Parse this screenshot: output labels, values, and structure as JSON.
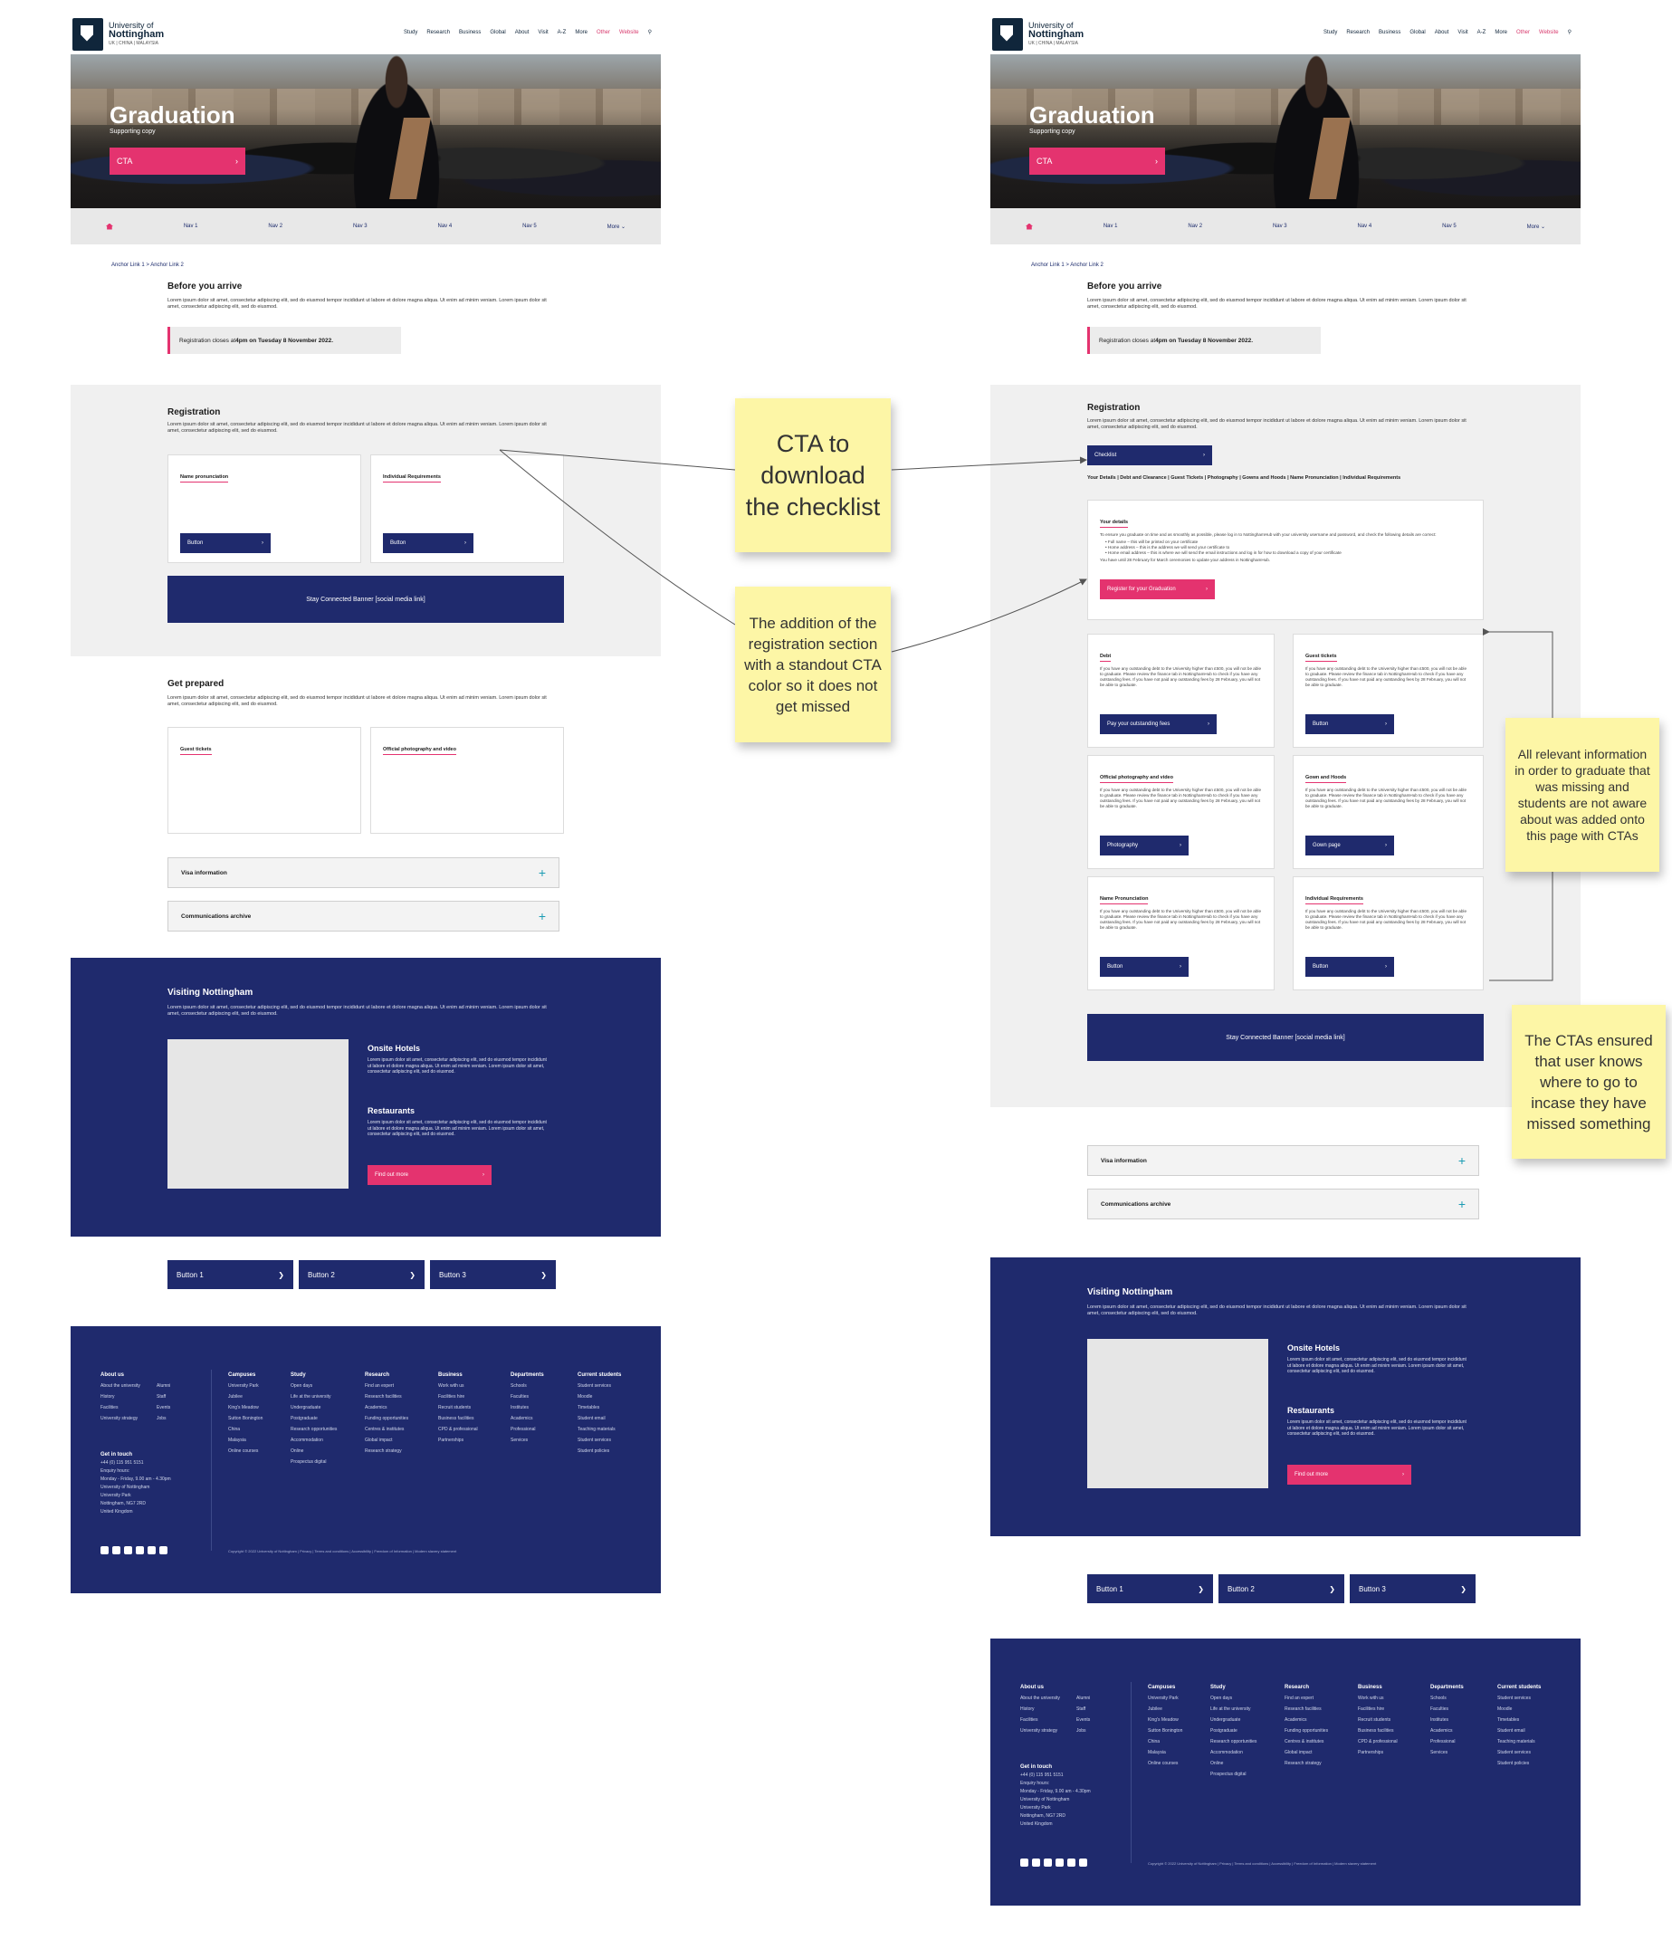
{
  "header": {
    "logo_line1": "University of",
    "logo_line2": "Nottingham",
    "logo_line3": "UK | CHINA | MALAYSIA",
    "nav": [
      "Study",
      "Research",
      "Business",
      "Global",
      "About",
      "Visit",
      "A-Z",
      "More"
    ],
    "lang": "Other",
    "website": "Website"
  },
  "hero": {
    "title": "Graduation",
    "supporting": "Supporting copy",
    "cta": "CTA"
  },
  "subnav": [
    "Nav 1",
    "Nav 2",
    "Nav 3",
    "Nav 4",
    "Nav 5",
    "More"
  ],
  "breadcrumb": "Anchor Link 1 > Anchor Link 2",
  "arrive": {
    "title": "Before you arrive",
    "text": "Lorem ipsum dolor sit amet, consectetur adipiscing elit, sed do eiusmod tempor incididunt ut labore et dolore magna aliqua. Ut enim ad minim veniam. Lorem ipsum dolor sit amet, consectetur adipiscing elit, sed do eiusmod.",
    "notice_pre": "Registration closes at ",
    "notice_bold": "4pm on Tuesday 8 November 2022."
  },
  "left": {
    "registration_title": "Registration",
    "registration_text": "Lorem ipsum dolor sit amet, consectetur adipiscing elit, sed do eiusmod tempor incididunt ut labore et dolore magna aliqua. Ut enim ad minim veniam. Lorem ipsum dolor sit amet, consectetur adipiscing elit, sed do eiusmod.",
    "cards": [
      {
        "title": "Name pronunciation",
        "button": "Button"
      },
      {
        "title": "Individual Requirements",
        "button": "Button"
      }
    ],
    "stay": "Stay Connected Banner [social media link]",
    "prepared_title": "Get prepared",
    "prepared_text": "Lorem ipsum dolor sit amet, consectetur adipiscing elit, sed do eiusmod tempor incididunt ut labore et dolore magna aliqua. Ut enim ad minim veniam. Lorem ipsum dolor sit amet, consectetur adipiscing elit, sed do eiusmod.",
    "prep_cards": [
      "Guest tickets",
      "Official photography and video"
    ]
  },
  "accordions": [
    "Visa information",
    "Communications archive"
  ],
  "visit": {
    "title": "Visiting Nottingham",
    "text": "Lorem ipsum dolor sit amet, consectetur adipiscing elit, sed do eiusmod tempor incididunt ut labore et dolore magna aliqua. Ut enim ad minim veniam. Lorem ipsum dolor sit amet, consectetur adipiscing elit, sed do eiusmod.",
    "hotels_title": "Onsite Hotels",
    "hotels_text": "Lorem ipsum dolor sit amet, consectetur adipiscing elit, sed do eiusmod tempor incididunt ut labore et dolore magna aliqua. Ut enim ad minim veniam. Lorem ipsum dolor sit amet, consectetur adipiscing elit, sed do eiusmod.",
    "rest_title": "Restaurants",
    "rest_text": "Lorem ipsum dolor sit amet, consectetur adipiscing elit, sed do eiusmod tempor incididunt ut labore et dolore magna aliqua. Ut enim ad minim veniam. Lorem ipsum dolor sit amet, consectetur adipiscing elit, sed do eiusmod.",
    "find": "Find out more"
  },
  "buttons": [
    "Button 1",
    "Button 2",
    "Button 3"
  ],
  "footer": {
    "about": "About us",
    "about_items": [
      "About the university",
      "History",
      "Facilities",
      "University strategy",
      "Alumni",
      "Staff",
      "Events",
      "Jobs"
    ],
    "contact": "Get in touch",
    "contact_lines": [
      "+44 (0) 115 951 5151",
      "Enquiry hours:",
      "Monday - Friday, 9.00 am - 4.30pm",
      "University of Nottingham",
      "University Park",
      "Nottingham, NG7 2RD",
      "United Kingdom"
    ],
    "campuses": "Campuses",
    "campuses_items": [
      "University Park",
      "Jubilee",
      "King's Meadow",
      "Sutton Bonington",
      "China",
      "Malaysia",
      "Online courses"
    ],
    "study": "Study",
    "study_items": [
      "Open days",
      "Life at the university",
      "Undergraduate",
      "Postgraduate",
      "Research opportunities",
      "Accommodation",
      "Online",
      "Prospectus digital"
    ],
    "research": "Research",
    "research_items": [
      "Find an expert",
      "Research facilities",
      "Academics",
      "Funding opportunities",
      "Centres & institutes",
      "Global impact",
      "Research strategy"
    ],
    "business": "Business",
    "business_items": [
      "Work with us",
      "Facilities hire",
      "Recruit students",
      "Business facilities",
      "CPD & professional",
      "Partnerships"
    ],
    "departments": "Departments",
    "departments_items": [
      "Schools",
      "Faculties",
      "Institutes",
      "Academics",
      "Professional",
      "Services"
    ],
    "current": "Current students",
    "current_items": [
      "Student services",
      "Moodle",
      "Timetables",
      "Student email",
      "Teaching materials",
      "Student services",
      "Student policies"
    ],
    "copyright": "Copyright © 2022 University of Nottingham | Privacy | Terms and conditions | Accessibility | Freedom of Information | Modern slavery statement"
  },
  "right": {
    "registration_title": "Registration",
    "registration_text": "Lorem ipsum dolor sit amet, consectetur adipiscing elit, sed do eiusmod tempor incididunt ut labore et dolore magna aliqua. Ut enim ad minim veniam. Lorem ipsum dolor sit amet, consectetur adipiscing elit, sed do eiusmod.",
    "checklist": "Checklist",
    "anchors": "Your Details | Debt and Clearance | Guest Tickets | Photography | Gowns and Hoods | Name Pronunciation | Individual Requirements",
    "details_title": "Your details",
    "details_text": "To ensure you graduate on time and as smoothly as possible, please log in to NottinghamHub with your university username and password, and check the following details are correct:",
    "details_bullets": [
      "Full name – this will be printed on your certificate",
      "Home address – this is the address we will send your certificate to",
      "Home email address – this is where we will send the email instructions and log in for how to download a copy of your certificate"
    ],
    "details_note": "You have until 28 February for March ceremonies to update your address in NottinghamHub.",
    "register": "Register for your Graduation",
    "cards": [
      {
        "title": "Debt",
        "button": "Pay your outstanding fees"
      },
      {
        "title": "Guest tickets",
        "button": "Button"
      },
      {
        "title": "Official photography and video",
        "button": "Photography"
      },
      {
        "title": "Gown and Hoods",
        "button": "Gown page"
      },
      {
        "title": "Name Pronunciation",
        "button": "Button"
      },
      {
        "title": "Individual Requirements",
        "button": "Button"
      }
    ],
    "card_text": "If you have any outstanding debt to the University higher than £500, you will not be able to graduate. Please review the finance tab in NottinghamHub to check if you have any outstanding fees. If you have not paid any outstanding fees by 28 February, you will not be able to graduate.",
    "stay": "Stay Connected Banner [social media link]"
  },
  "notes": {
    "checklist": "CTA to download the checklist",
    "registration": "The addition of the registration section with a standout CTA color so it does not get missed",
    "relevant": "All relevant information in order to graduate that was missing and students are not aware about was added onto this page with CTAs",
    "ensured": "The CTAs ensured that user knows where to go to incase they have missed something"
  },
  "colors": {
    "navy": "#1f2a6d",
    "pink": "#e4336f",
    "sticky": "#fdf6a6",
    "grey": "#f0f0f0"
  }
}
